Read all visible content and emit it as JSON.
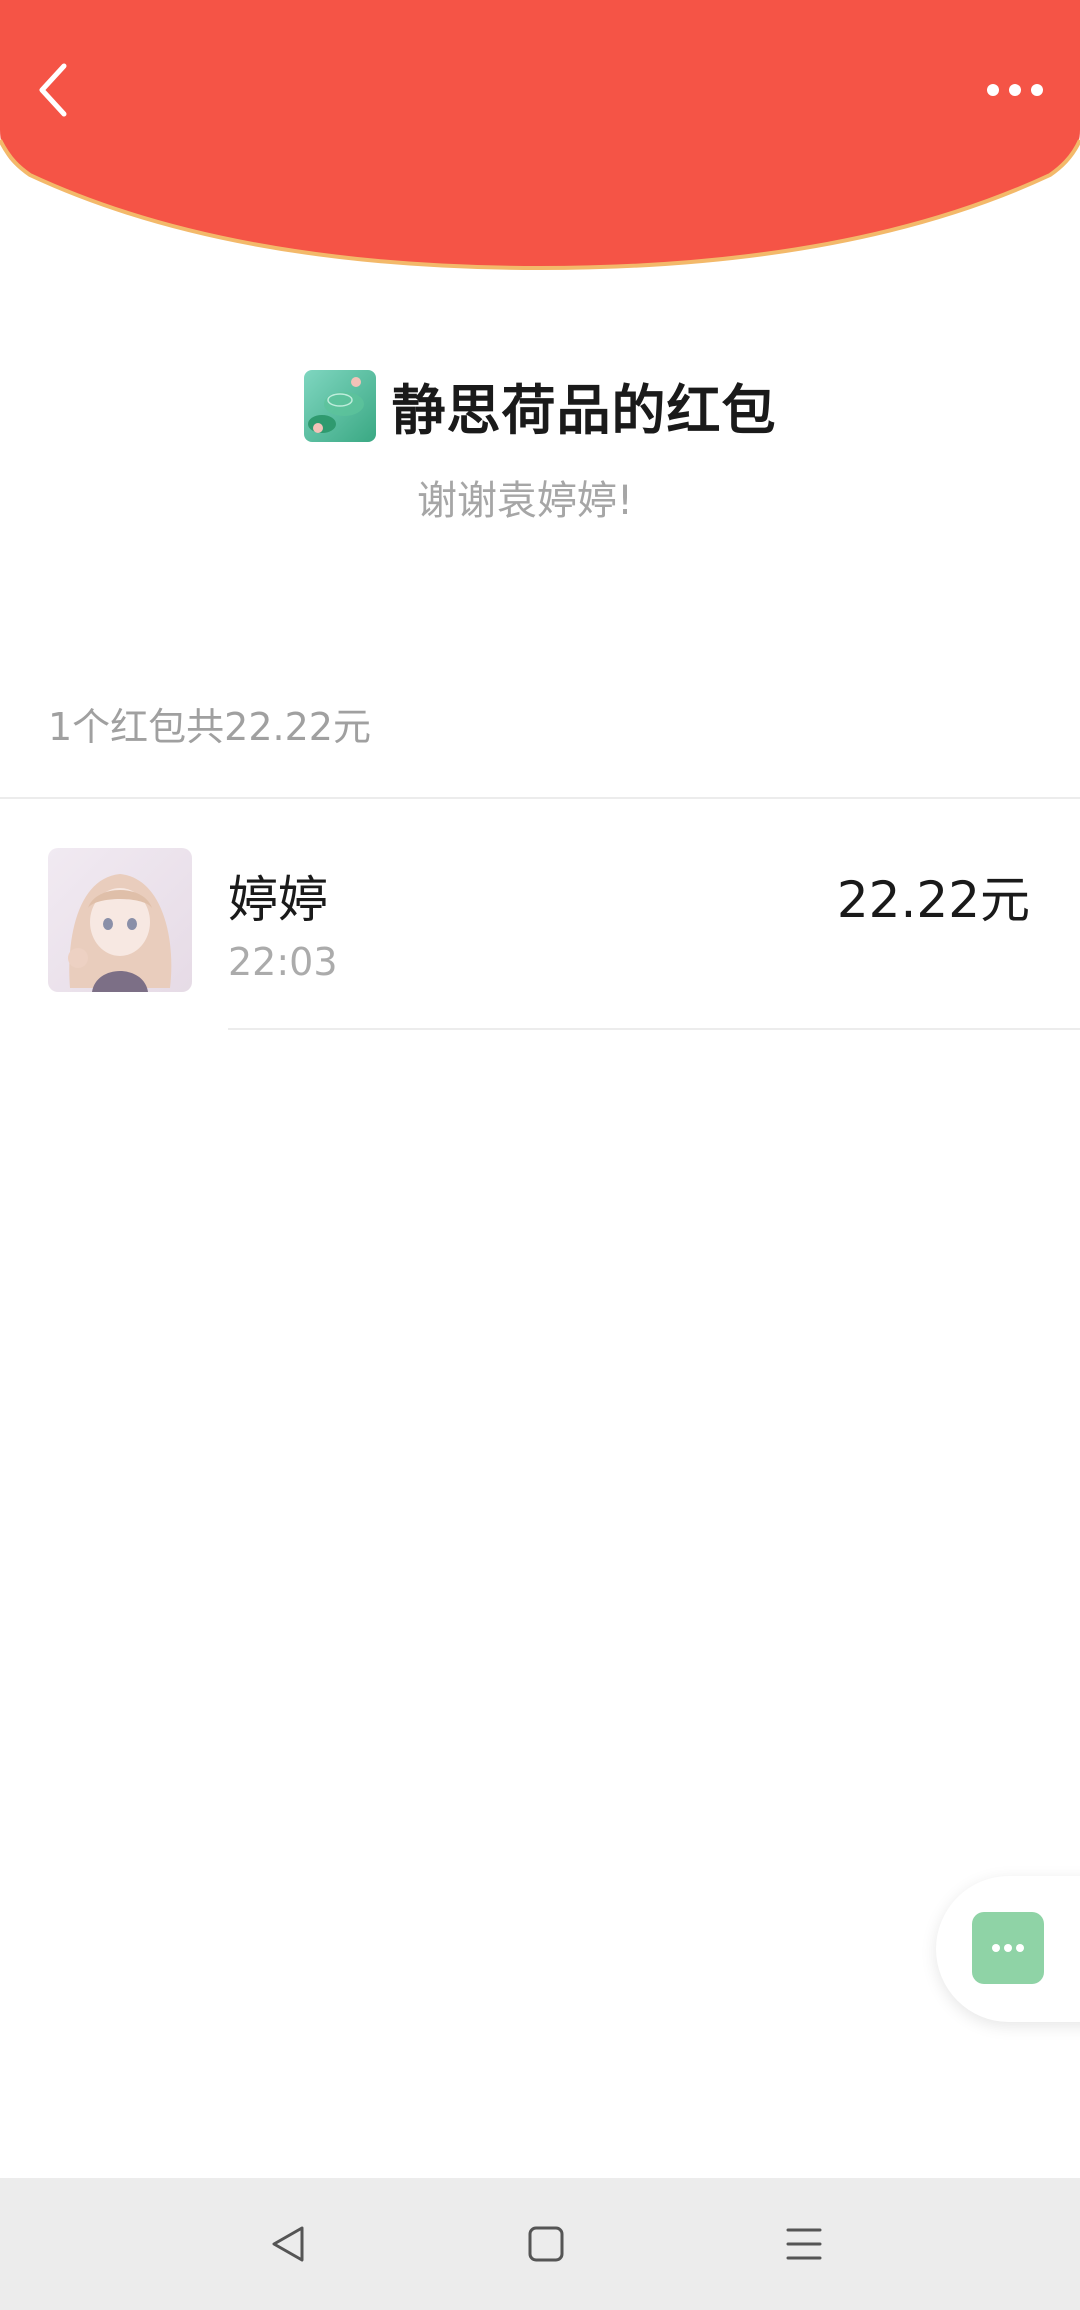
{
  "header": {
    "back_icon": "chevron-left-icon",
    "more_icon": "more-horizontal-icon",
    "background_color": "#f55446",
    "curve_border_color": "#f3b96a"
  },
  "sender": {
    "title": "静思荷品的红包",
    "greeting": "谢谢袁婷婷!",
    "avatar": "lotus-pond-avatar"
  },
  "summary": {
    "text": "1个红包共22.22元"
  },
  "receivers": [
    {
      "name": "婷婷",
      "time": "22:03",
      "amount": "22.22元",
      "avatar": "anime-girl-avatar"
    }
  ],
  "floating": {
    "icon": "chat-bubble-icon",
    "color": "#8fd3a6"
  },
  "navbar": {
    "back_icon": "triangle-back-icon",
    "home_icon": "square-home-icon",
    "menu_icon": "hamburger-menu-icon"
  }
}
